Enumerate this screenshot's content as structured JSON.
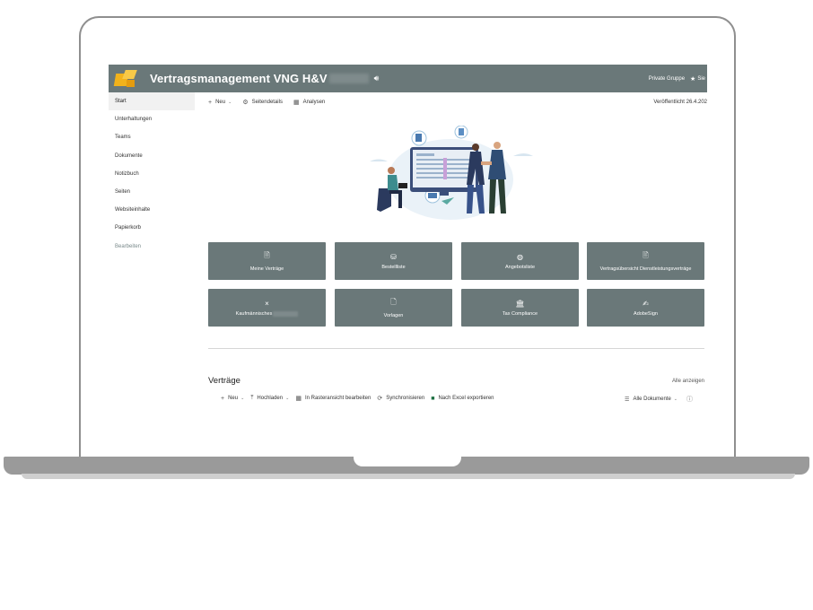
{
  "header": {
    "site_title": "Vertragsmanagement VNG H&V",
    "group_label": "Private Gruppe",
    "follow_label": "Sie"
  },
  "sidebar": {
    "items": [
      {
        "label": "Start"
      },
      {
        "label": "Unterhaltungen"
      },
      {
        "label": "Teams"
      },
      {
        "label": "Dokumente"
      },
      {
        "label": "Notizbuch"
      },
      {
        "label": "Seiten"
      },
      {
        "label": "Websiteinhalte"
      },
      {
        "label": "Papierkorb"
      },
      {
        "label": "Bearbeiten"
      }
    ]
  },
  "commandbar": {
    "new_label": "Neu",
    "page_details_label": "Seitendetails",
    "analytics_label": "Analysen",
    "published_label": "Veröffentlicht 26.4.202"
  },
  "tiles": [
    {
      "label": "Meine Verträge",
      "icon": "document-icon"
    },
    {
      "label": "Bestellliste",
      "icon": "shopping-bag-icon"
    },
    {
      "label": "Angebotsliste",
      "icon": "globe-icon"
    },
    {
      "label": "Vertragsübersicht Dienstleistungsverträge",
      "icon": "edit-document-icon"
    },
    {
      "label": "Kaufmännisches",
      "icon": "close-icon"
    },
    {
      "label": "Vorlagen",
      "icon": "blank-page-icon"
    },
    {
      "label": "Tax Compliance",
      "icon": "bank-icon"
    },
    {
      "label": "AdobeSign",
      "icon": "signature-icon"
    }
  ],
  "list": {
    "title": "Verträge",
    "show_all": "Alle anzeigen",
    "new_label": "Neu",
    "upload_label": "Hochladen",
    "grid_edit_label": "In Rasteransicht bearbeiten",
    "sync_label": "Synchronisieren",
    "excel_label": "Nach Excel exportieren",
    "view_label": "Alle Dokumente"
  },
  "colors": {
    "brand": "#6a7879",
    "accent": "#f2b21b"
  }
}
